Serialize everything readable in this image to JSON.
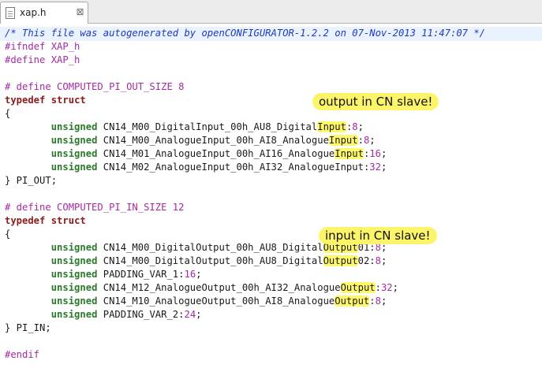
{
  "tab": {
    "filename": "xap.h",
    "close_glyph": "⊠",
    "icon": "text-file-icon"
  },
  "code": {
    "comment": "/* This file was autogenerated by openCONFIGURATOR-1.2.2 on 07-Nov-2013 11:47:07 */",
    "ifndef": "#ifndef XAP_h",
    "define": "#define XAP_h",
    "define_out": "# define COMPUTED_PI_OUT_SIZE 8",
    "typedef": "typedef",
    "struct": "struct",
    "brace_open": "{",
    "unsigned": "unsigned",
    "out_fields": [
      {
        "pre": "CN14_M00_DigitalInput_00h_AU8_Digital",
        "hl": "Input",
        "post": ":",
        "num": "8",
        "end": ";"
      },
      {
        "pre": "CN14_M00_AnalogueInput_00h_AI8_Analogue",
        "hl": "Input",
        "post": ":",
        "num": "8",
        "end": ";"
      },
      {
        "pre": "CN14_M01_AnalogueInput_00h_AI16_Analogue",
        "hl": "Input",
        "post": ":",
        "num": "16",
        "end": ";"
      },
      {
        "pre": "CN14_M02_AnalogueInput_00h_AI32_AnalogueInput",
        "hl": "",
        "post": ":",
        "num": "32",
        "end": ";"
      }
    ],
    "pi_out": "} PI_OUT;",
    "define_in": "# define COMPUTED_PI_IN_SIZE 12",
    "in_fields": [
      {
        "pre": "CN14_M00_DigitalOutput_00h_AU8_Digital",
        "hl": "Output",
        "post": "01:",
        "num": "8",
        "end": ";"
      },
      {
        "pre": "CN14_M00_DigitalOutput_00h_AU8_Digital",
        "hl": "Output",
        "post": "02:",
        "num": "8",
        "end": ";"
      },
      {
        "pre": "PADDING_VAR_1",
        "hl": "",
        "post": ":",
        "num": "16",
        "end": ";"
      },
      {
        "pre": "CN14_M12_AnalogueOutput_00h_AI32_Analogue",
        "hl": "Output",
        "post": ":",
        "num": "32",
        "end": ";"
      },
      {
        "pre": "CN14_M10_AnalogueOutput_00h_AI8_Analogue",
        "hl": "Output",
        "post": ":",
        "num": "8",
        "end": ";"
      },
      {
        "pre": "PADDING_VAR_2",
        "hl": "",
        "post": ":",
        "num": "24",
        "end": ";"
      }
    ],
    "pi_in": "} PI_IN;",
    "endif": "#endif"
  },
  "annotations": {
    "output_note": "output in CN slave!",
    "input_note": "input in CN slave!"
  },
  "colors": {
    "comment": "#1d39c4",
    "preprocessor": "#a42ba4",
    "keyword": "#8b1a1a",
    "type": "#2b7a2b",
    "highlight": "#fdf86b"
  }
}
